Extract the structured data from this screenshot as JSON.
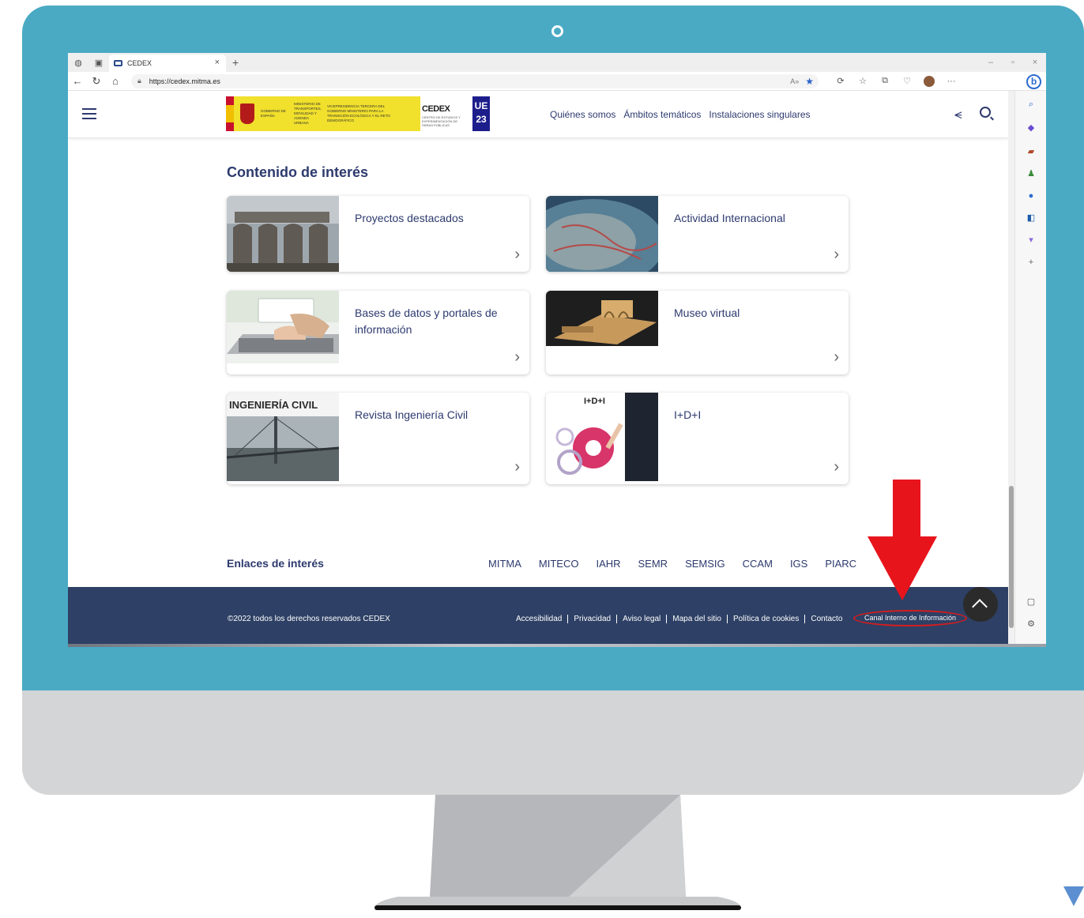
{
  "browser": {
    "tab_title": "CEDEX",
    "url": "https://cedex.mitma.es",
    "bing_label": "b"
  },
  "header": {
    "nav": [
      "Quiénes somos",
      "Ámbitos temáticos",
      "Instalaciones singulares"
    ],
    "logos": {
      "gob": [
        "GOBIERNO DE ESPAÑA",
        "MINISTERIO DE TRANSPORTES, MOVILIDAD Y AGENDA URBANA",
        "VICEPRESIDENCIA TERCERA DEL GOBIERNO MINISTERIO PARA LA TRANSICIÓN ECOLÓGICA Y EL RETO DEMOGRÁFICO"
      ],
      "cedex": "CEDEX",
      "cedex_sub": "CENTRO DE ESTUDIOS Y EXPERIMENTACIÓN DE OBRAS PÚBLICAS",
      "ue": "UE 23"
    }
  },
  "content": {
    "section_title": "Contenido de interés",
    "cards": [
      {
        "title": "Proyectos destacados"
      },
      {
        "title": "Actividad Internacional"
      },
      {
        "title": "Bases de datos y portales de información"
      },
      {
        "title": "Museo virtual"
      },
      {
        "title": "Revista Ingeniería Civil",
        "image_text": "INGENIERÍA CIVIL"
      },
      {
        "title": "I+D+I",
        "image_text": "I+D+I"
      }
    ]
  },
  "links": {
    "title": "Enlaces de interés",
    "items": [
      "MITMA",
      "MITECO",
      "IAHR",
      "SEMR",
      "SEMSIG",
      "CCAM",
      "IGS",
      "PIARC"
    ]
  },
  "footer": {
    "copyright": "©2022 todos los derechos reservados CEDEX",
    "links": [
      "Accesibilidad",
      "Privacidad",
      "Aviso legal",
      "Mapa del sitio",
      "Política de cookies",
      "Contacto"
    ],
    "canal": "Canal Interno de Información"
  },
  "colors": {
    "bezel": "#4aaac4",
    "brand_navy": "#2d3a6e",
    "footer_bg": "#2e4065",
    "highlight_red": "#d81c1c"
  }
}
